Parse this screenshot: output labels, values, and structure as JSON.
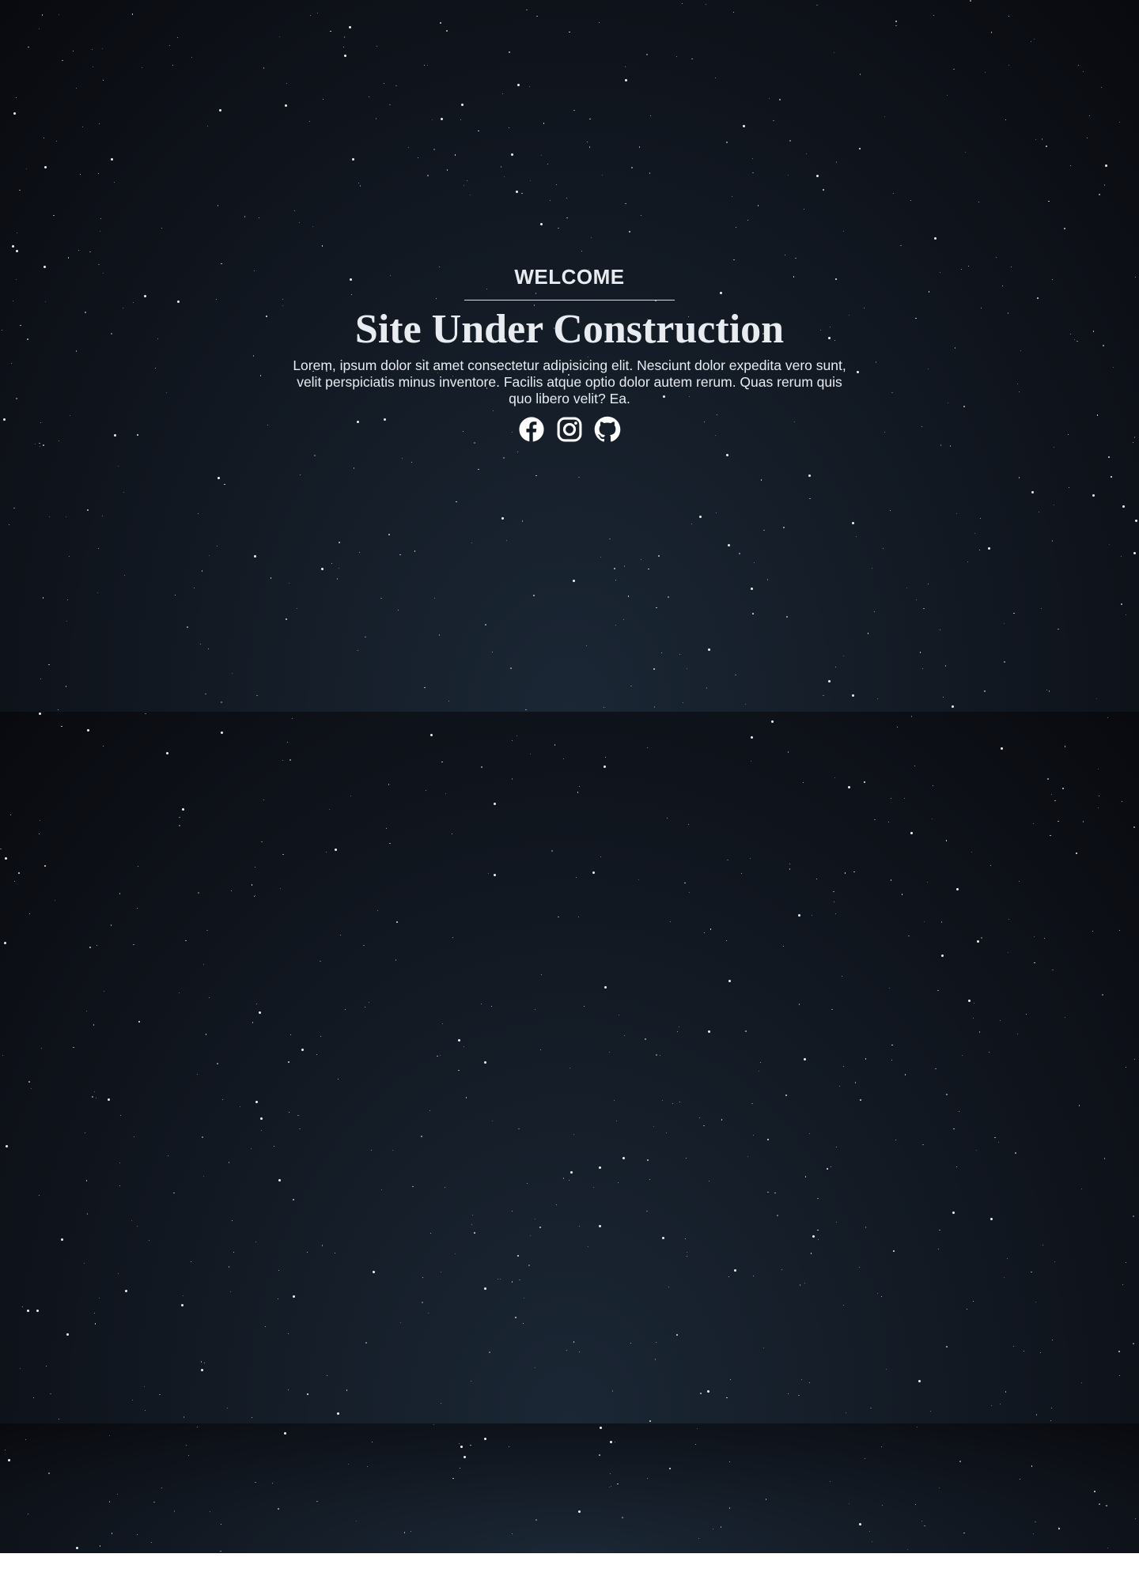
{
  "hero": {
    "eyebrow": "WELCOME",
    "title": "Site Under Construction",
    "description": "Lorem, ipsum dolor sit amet consectetur adipisicing elit. Nesciunt dolor expedita vero sunt, velit perspiciatis minus inventore. Facilis atque optio dolor autem rerum. Quas rerum quis quo libero velit? Ea."
  },
  "socials": [
    {
      "icon": "facebook-icon"
    },
    {
      "icon": "instagram-icon"
    },
    {
      "icon": "github-icon"
    }
  ],
  "colors": {
    "background_center": "#1b2735",
    "background_edge": "#090a0f",
    "text": "#e8ecf1",
    "star": "#ffffff"
  }
}
